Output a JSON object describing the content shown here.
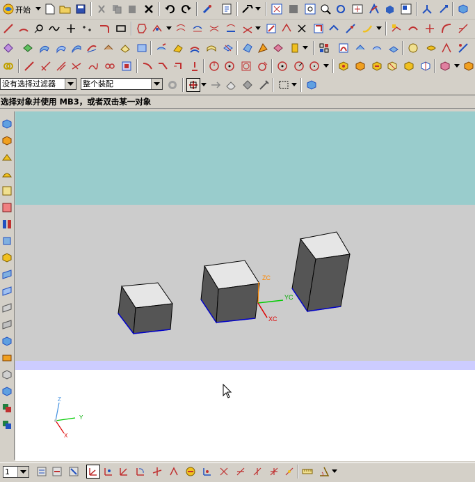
{
  "toolbar": {
    "start_label": "开始",
    "start_icon": "nx-start-icon",
    "selection_filter": "没有选择过滤器",
    "selection_scope": "整个装配"
  },
  "status_prompt": "选择对象并使用 MB3，或者双击某一对象",
  "viewport": {
    "background_top": "#99cccc",
    "background_mid": "#cccccc",
    "background_band": "#ccccff",
    "background_bottom": "#ffffff",
    "wcs_axes": {
      "z": "ZC",
      "y": "YC",
      "x": "XC"
    },
    "absolute_axes": {
      "z": "Z",
      "y": "Y",
      "x": "X"
    }
  },
  "layer": {
    "value": "1"
  },
  "colors": {
    "face_top": "#e6e6e6",
    "face_side": "#555555",
    "edge_black": "#000000",
    "edge_blue": "#0000cc",
    "axis_z": "#ff8800",
    "axis_y": "#00cc00",
    "axis_x": "#dd0000"
  }
}
